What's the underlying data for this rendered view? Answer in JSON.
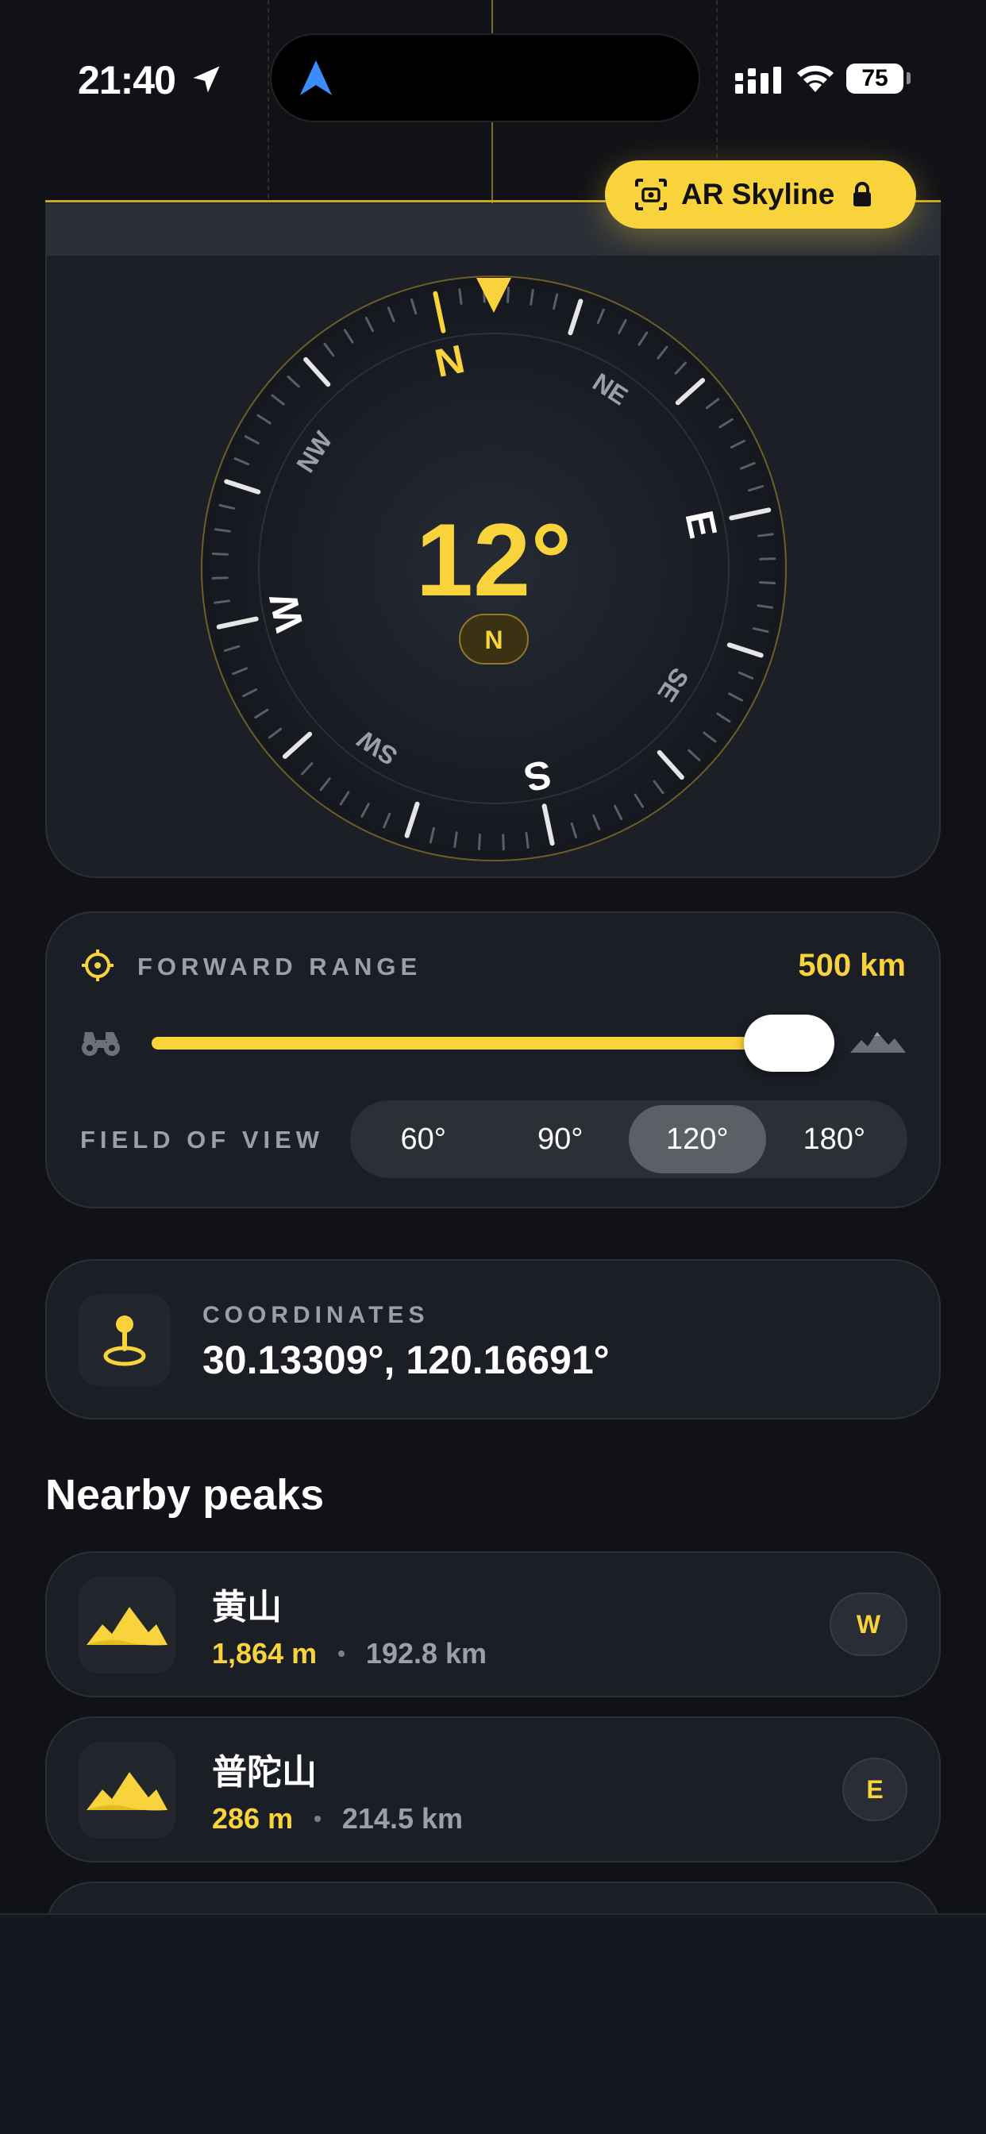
{
  "status_bar": {
    "time": "21:40",
    "battery": "75"
  },
  "ar": {
    "button_label": "AR Skyline"
  },
  "compass": {
    "heading": "12°",
    "heading_badge": "N",
    "cardinals": [
      "N",
      "E",
      "S",
      "W"
    ],
    "intercardinals": [
      "NE",
      "SE",
      "SW",
      "NW"
    ],
    "accent": "#f9d33b"
  },
  "range": {
    "title": "FORWARD RANGE",
    "value": "500 km",
    "slider_fraction": 1.0
  },
  "fov": {
    "label": "FIELD OF VIEW",
    "options": [
      "60°",
      "90°",
      "120°",
      "180°"
    ],
    "selected": "120°"
  },
  "coordinates": {
    "label": "COORDINATES",
    "value": "30.13309°, 120.16691°"
  },
  "nearby": {
    "title": "Nearby peaks",
    "peaks": [
      {
        "name": "黄山",
        "elevation": "1,864 m",
        "distance": "192.8 km",
        "direction": "W"
      },
      {
        "name": "普陀山",
        "elevation": "286 m",
        "distance": "214.5 km",
        "direction": "E"
      }
    ]
  }
}
